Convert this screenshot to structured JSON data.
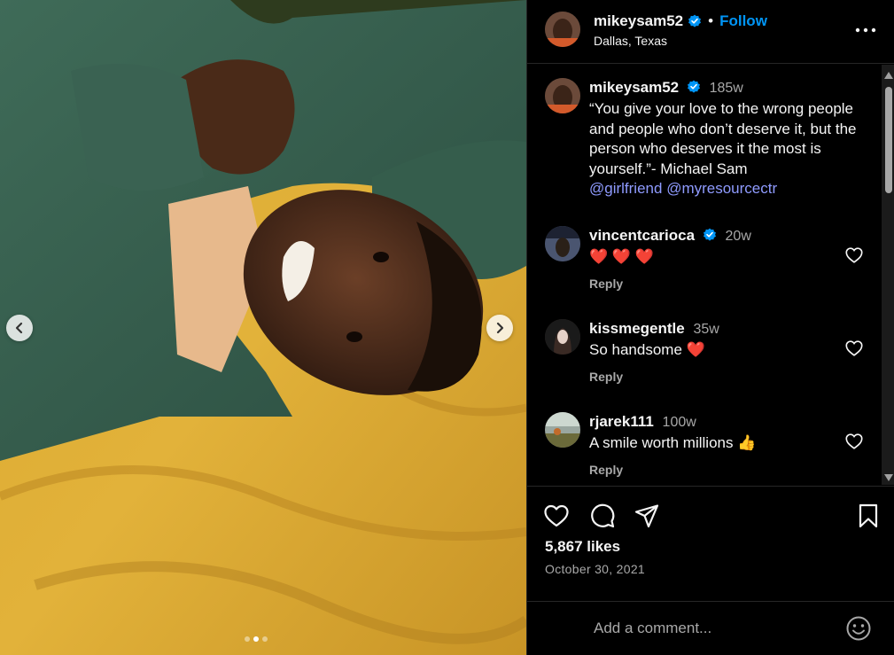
{
  "post": {
    "username": "mikeysam52",
    "location": "Dallas, Texas",
    "follow_label": "Follow",
    "separator": "•",
    "verified": true,
    "media": {
      "slide_count": 3,
      "active_slide": 2,
      "prev_icon": "chevron-left-icon",
      "next_icon": "chevron-right-icon"
    }
  },
  "caption": {
    "username": "mikeysam52",
    "time": "185w",
    "text": "“You give your love to the wrong people and people who don’t deserve it, but the person who deserves it the most is yourself.”- Michael Sam",
    "mentions": [
      "@girlfriend",
      "@myresourcectr"
    ]
  },
  "comments": [
    {
      "username": "vincentcarioca",
      "verified": true,
      "time": "20w",
      "text": "❤️ ❤️ ❤️",
      "reply_label": "Reply"
    },
    {
      "username": "kissmegentle",
      "verified": false,
      "time": "35w",
      "text": "So handsome ❤️",
      "reply_label": "Reply"
    },
    {
      "username": "rjarek111",
      "verified": false,
      "time": "100w",
      "text": "A smile worth millions 👍",
      "reply_label": "Reply"
    }
  ],
  "actions": {
    "likes": "5,867 likes",
    "date": "October 30, 2021",
    "icons": [
      "heart-icon",
      "comment-icon",
      "share-icon",
      "bookmark-icon"
    ]
  },
  "composer": {
    "placeholder": "Add a comment...",
    "emoji_icon": "smiley-icon"
  },
  "colors": {
    "background": "#000000",
    "text": "#f5f5f5",
    "secondary": "#a8a8a8",
    "link": "#0095f6",
    "mention": "#8f9bff",
    "heart": "#ff3040",
    "divider": "#262626"
  }
}
